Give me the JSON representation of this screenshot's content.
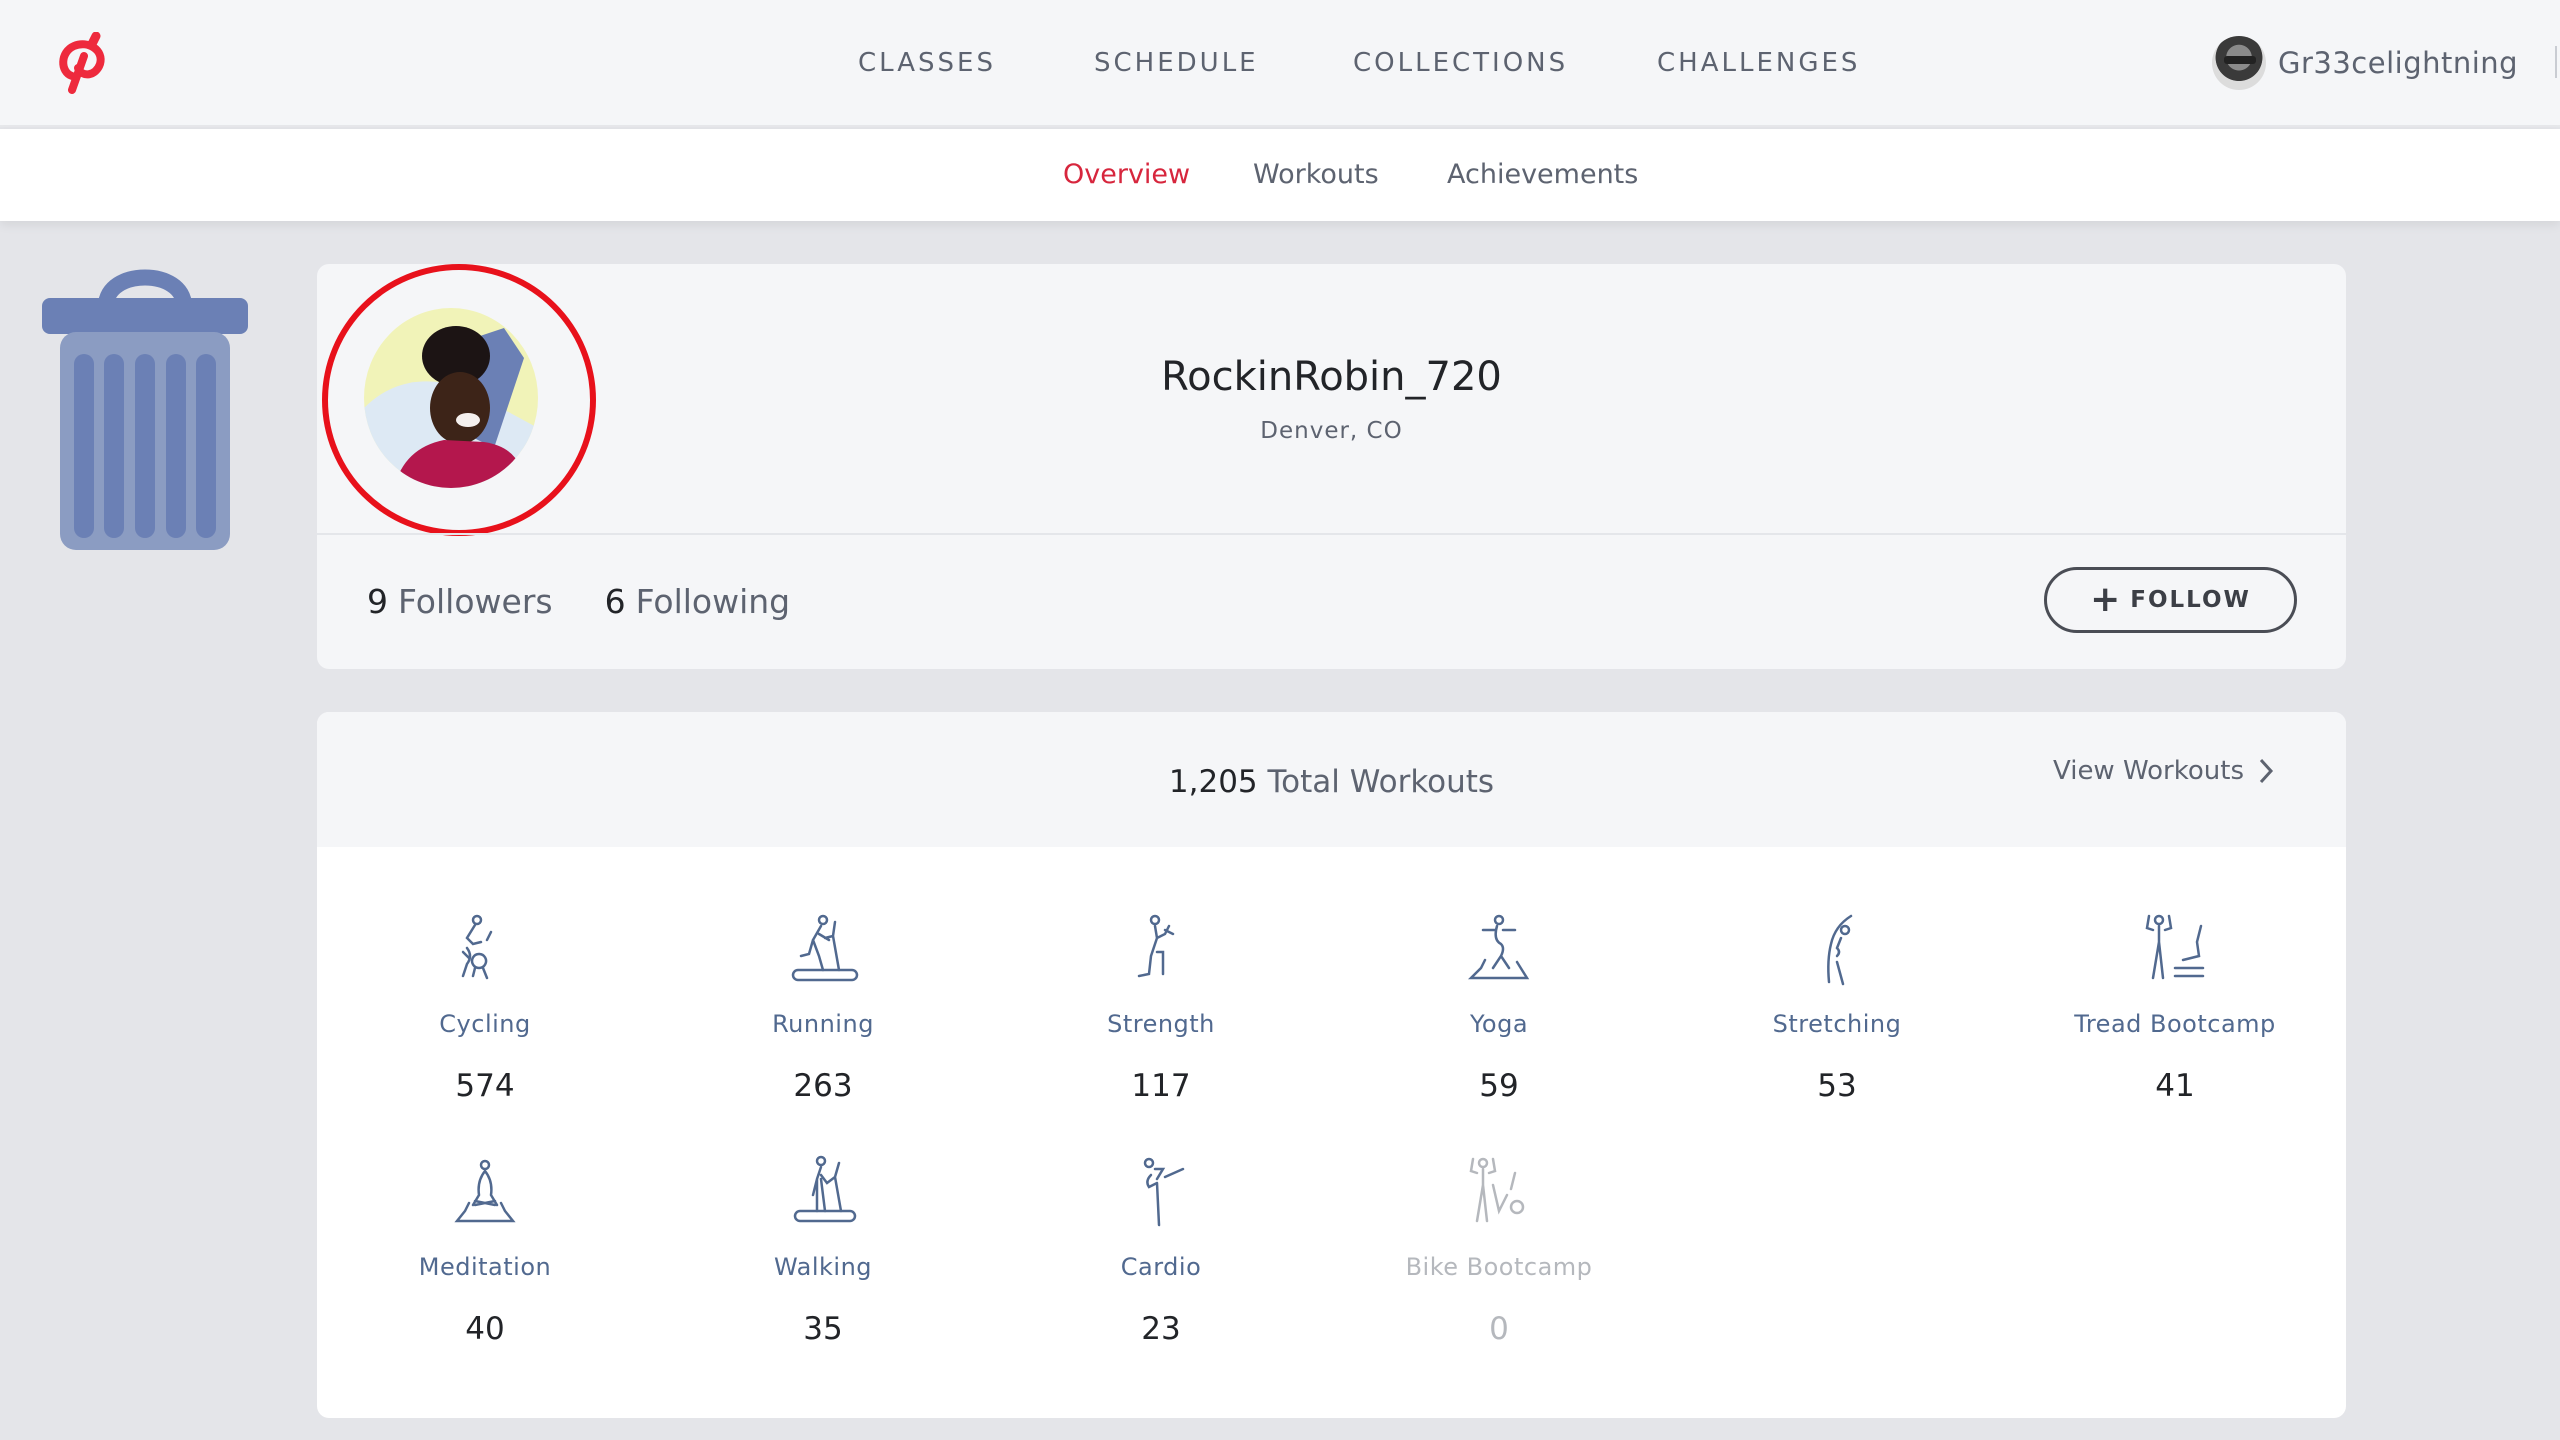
{
  "header": {
    "logo_icon": "peloton-logo-icon",
    "nav": [
      "CLASSES",
      "SCHEDULE",
      "COLLECTIONS",
      "CHALLENGES"
    ],
    "user": {
      "username": "Gr33celightning",
      "avatar_icon": "user-avatar"
    }
  },
  "subnav": {
    "tabs": [
      {
        "label": "Overview",
        "active": true
      },
      {
        "label": "Workouts",
        "active": false
      },
      {
        "label": "Achievements",
        "active": false
      }
    ]
  },
  "overlay": {
    "icon": "trash-icon",
    "highlight_color": "#e8111b"
  },
  "profile": {
    "username": "RockinRobin_720",
    "location": "Denver, CO",
    "followers_count": "9",
    "followers_label": "Followers",
    "following_count": "6",
    "following_label": "Following",
    "follow_button": {
      "icon": "+",
      "label": "FOLLOW"
    }
  },
  "workouts": {
    "total": "1,205",
    "total_label": "Total Workouts",
    "view_link": "View Workouts",
    "categories": [
      {
        "name": "Cycling",
        "count": "574",
        "icon": "cycling-icon",
        "disabled": false
      },
      {
        "name": "Running",
        "count": "263",
        "icon": "running-icon",
        "disabled": false
      },
      {
        "name": "Strength",
        "count": "117",
        "icon": "strength-icon",
        "disabled": false
      },
      {
        "name": "Yoga",
        "count": "59",
        "icon": "yoga-icon",
        "disabled": false
      },
      {
        "name": "Stretching",
        "count": "53",
        "icon": "stretching-icon",
        "disabled": false
      },
      {
        "name": "Tread Bootcamp",
        "count": "41",
        "icon": "tread-bootcamp-icon",
        "disabled": false
      },
      {
        "name": "Meditation",
        "count": "40",
        "icon": "meditation-icon",
        "disabled": false
      },
      {
        "name": "Walking",
        "count": "35",
        "icon": "walking-icon",
        "disabled": false
      },
      {
        "name": "Cardio",
        "count": "23",
        "icon": "cardio-icon",
        "disabled": false
      },
      {
        "name": "Bike Bootcamp",
        "count": "0",
        "icon": "bike-bootcamp-icon",
        "disabled": true
      }
    ]
  },
  "colors": {
    "accent": "#d7263d",
    "category_label": "#51698f",
    "trash": "#6b80b5"
  }
}
